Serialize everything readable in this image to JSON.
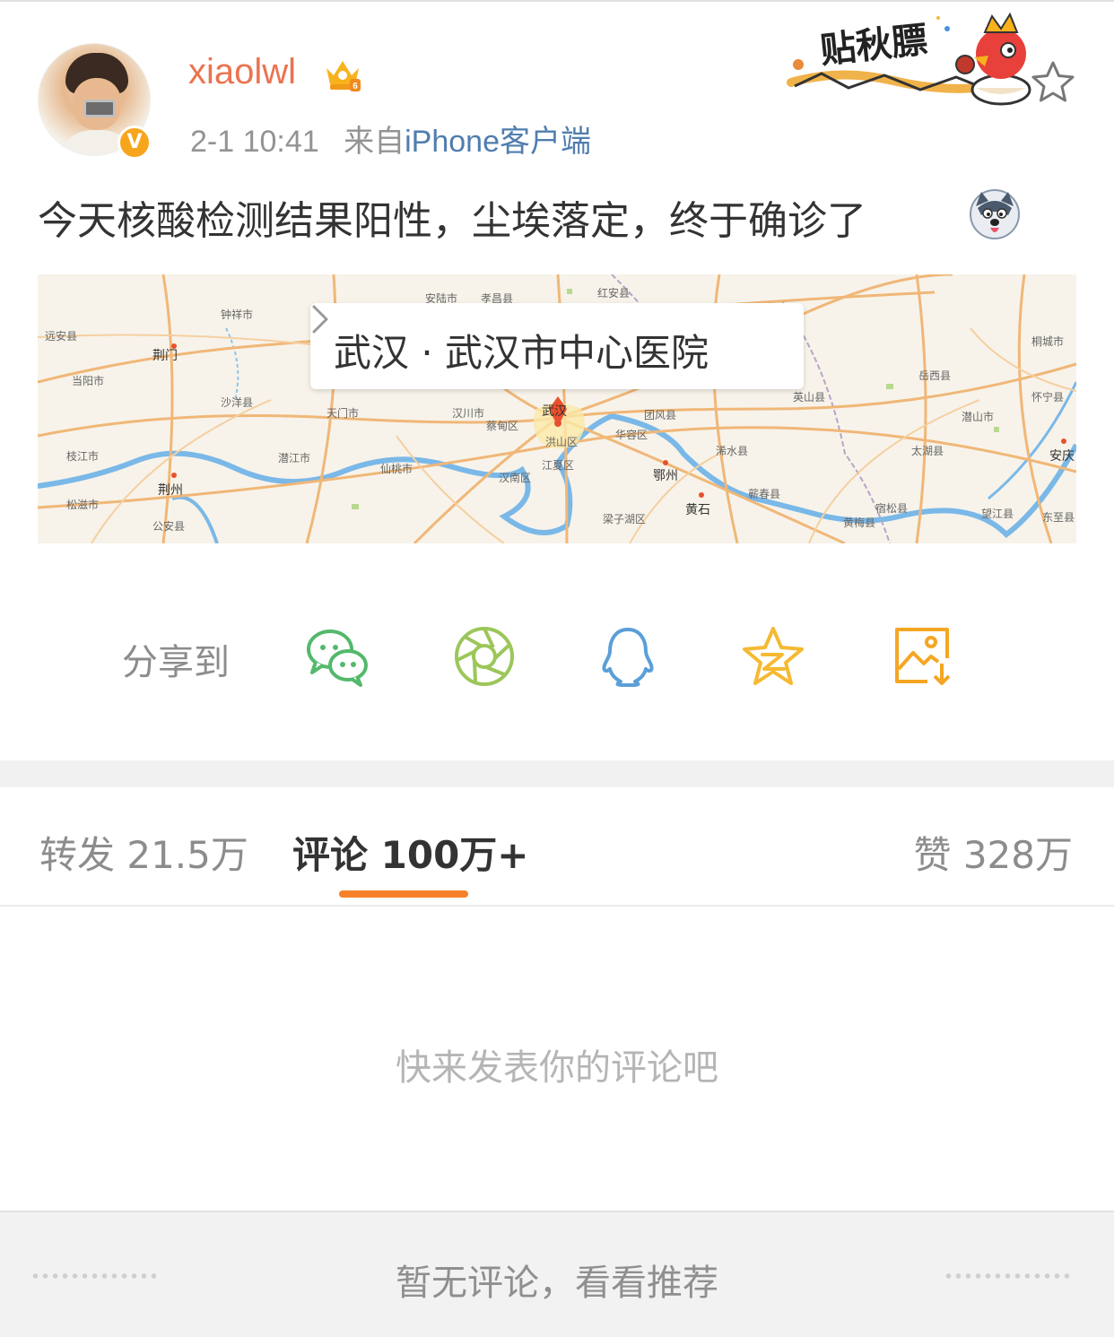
{
  "post": {
    "username": "xiaolwl",
    "time": "2-1 10:41",
    "from_prefix": "来自",
    "source": "iPhone客户端",
    "text": "今天核酸检测结果阳性，尘埃落定，终于确诊了"
  },
  "sticker": {
    "text": "贴秋膘"
  },
  "location": {
    "label": "武汉 · 武汉市中心医院",
    "places": [
      "远安县",
      "钟祥市",
      "荆门",
      "当阳市",
      "沙洋县",
      "天门市",
      "汉川市",
      "蔡甸区",
      "武汉",
      "洪山区",
      "江夏区",
      "汉南区",
      "华容区",
      "团风县",
      "鄂州",
      "黄石",
      "浠水县",
      "蕲春县",
      "英山县",
      "岳西县",
      "潜山市",
      "怀宁县",
      "太湖县",
      "宿松县",
      "黄梅县",
      "望江县",
      "东至县",
      "安庆",
      "桐城市",
      "枝江市",
      "荆州",
      "松滋市",
      "公安县",
      "潜江市",
      "仙桃市",
      "梁子湖区",
      "安陆市",
      "孝昌县",
      "红安县"
    ]
  },
  "share": {
    "label": "分享到",
    "targets": [
      "wechat-icon",
      "moments-icon",
      "qq-icon",
      "qzone-icon",
      "save-image-icon"
    ],
    "colors": {
      "wechat": "#53b96c",
      "moments": "#9cc65a",
      "qq": "#5a9fd8",
      "qzone": "#f5b932",
      "save": "#f5a623"
    }
  },
  "tabs": {
    "repost": "转发 21.5万",
    "comment": "评论 100万+",
    "like": "赞 328万"
  },
  "comments": {
    "empty_prompt": "快来发表你的评论吧"
  },
  "footer": {
    "text": "暂无评论，看看推荐"
  },
  "colors": {
    "accent": "#eb7350",
    "link": "#507daf",
    "tab_indicator": "#f5822a"
  }
}
